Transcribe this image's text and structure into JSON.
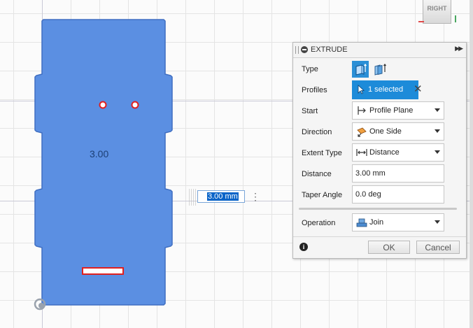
{
  "viewport": {
    "body_dimension_label": "3.00",
    "viewcube_face": "RIGHT",
    "inline_distance_value": "3.00 mm"
  },
  "extrude_panel": {
    "title": "EXTRUDE",
    "labels": {
      "type": "Type",
      "profiles": "Profiles",
      "start": "Start",
      "direction": "Direction",
      "extent_type": "Extent Type",
      "distance": "Distance",
      "taper_angle": "Taper Angle",
      "operation": "Operation"
    },
    "profiles_selection": "1 selected",
    "start_value": "Profile Plane",
    "direction_value": "One Side",
    "extent_type_value": "Distance",
    "distance_value": "3.00 mm",
    "taper_angle_value": "0.0 deg",
    "operation_value": "Join",
    "ok_label": "OK",
    "cancel_label": "Cancel"
  },
  "icons": {
    "collapse": "collapse-icon",
    "expand": "double-chevron-right-icon",
    "type_solid": "extrude-solid-icon",
    "type_thin": "extrude-thin-icon",
    "profile_select": "cursor-icon",
    "clear": "close-icon",
    "start": "profile-plane-icon",
    "direction": "one-side-icon",
    "extent": "distance-arrows-icon",
    "operation": "join-icon",
    "info": "info-icon",
    "orbit": "orbit-icon"
  },
  "colors": {
    "body_fill": "#5b8fe2",
    "body_stroke": "#3f6ec1",
    "accent": "#1d8bd9",
    "hole_outline": "#e02020"
  }
}
